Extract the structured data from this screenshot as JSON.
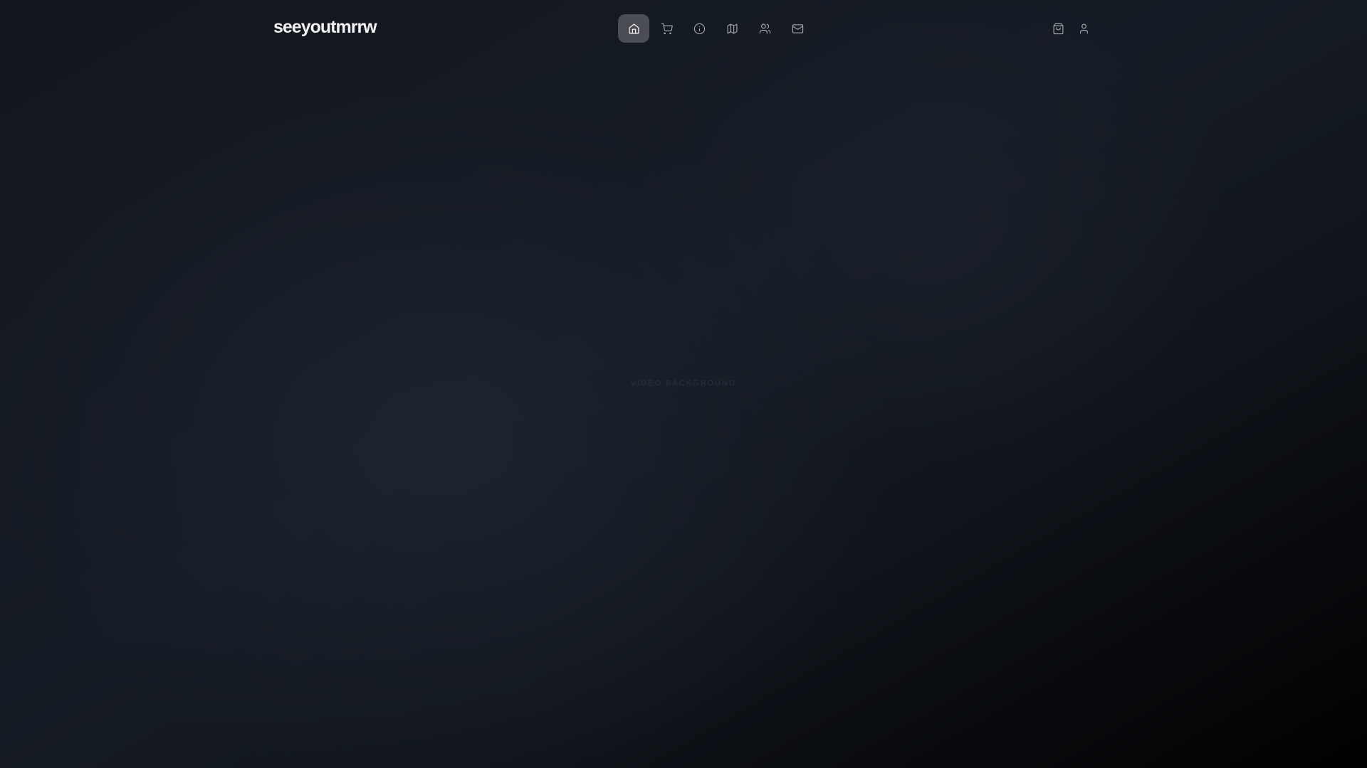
{
  "brand": {
    "logo": "seeyoutmrrw"
  },
  "nav": {
    "items": [
      {
        "name": "home",
        "active": true
      },
      {
        "name": "shop"
      },
      {
        "name": "about"
      },
      {
        "name": "map"
      },
      {
        "name": "community"
      },
      {
        "name": "contact"
      }
    ]
  },
  "actions": [
    "cart",
    "account"
  ],
  "main": {
    "placeholder": "VIDEO BACKGROUND"
  },
  "colors": {
    "active_bg": "#4a4d53",
    "bg": "#131820"
  }
}
